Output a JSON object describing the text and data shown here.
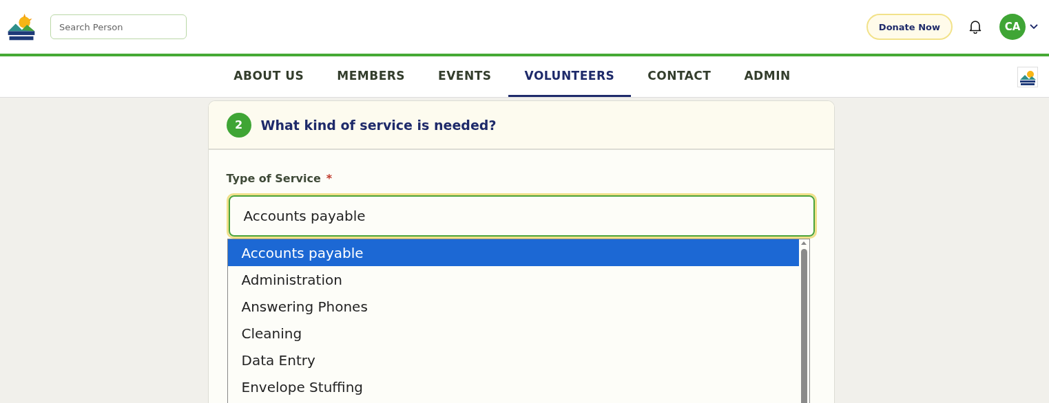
{
  "header": {
    "search": {
      "placeholder": "Search Person"
    },
    "donate_button": "Donate Now",
    "avatar": "CA"
  },
  "nav": [
    {
      "label": "ABOUT US",
      "selected": false
    },
    {
      "label": "MEMBERS",
      "selected": false
    },
    {
      "label": "EVENTS",
      "selected": false
    },
    {
      "label": "VOLUNTEERS",
      "selected": true
    },
    {
      "label": "CONTACT",
      "selected": false
    },
    {
      "label": "ADMIN",
      "selected": false
    }
  ],
  "step": {
    "number": "2",
    "title": "What kind of service is needed?"
  },
  "field": {
    "label": "Type of Service",
    "required_mark": "*",
    "value": "Accounts payable"
  },
  "options": [
    {
      "label": "Accounts payable",
      "selected": true
    },
    {
      "label": "Administration",
      "selected": false
    },
    {
      "label": "Answering Phones",
      "selected": false
    },
    {
      "label": "Cleaning",
      "selected": false
    },
    {
      "label": "Data Entry",
      "selected": false
    },
    {
      "label": "Envelope Stuffing",
      "selected": false
    }
  ]
}
